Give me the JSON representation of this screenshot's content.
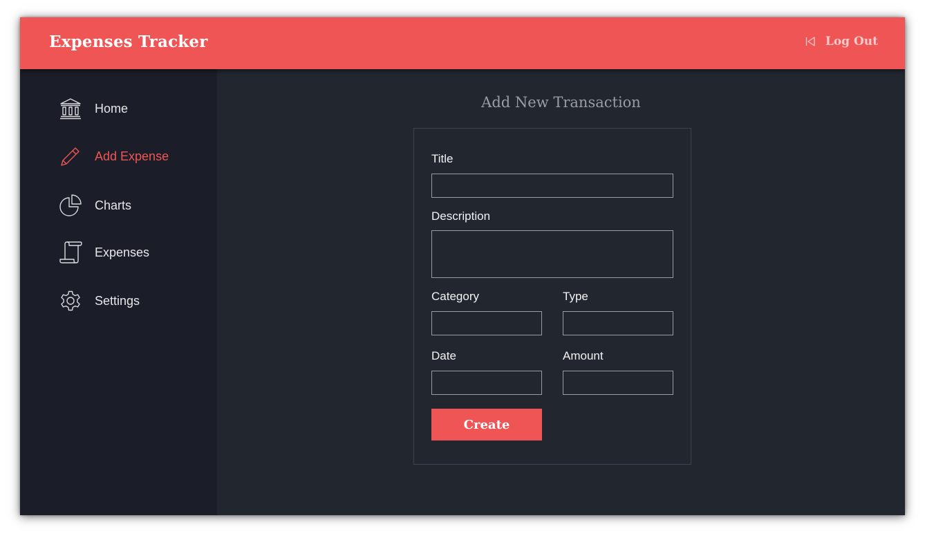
{
  "header": {
    "app_title": "Expenses Tracker",
    "logout_label": "Log Out",
    "logout_icon": "logout-icon"
  },
  "sidebar": {
    "items": [
      {
        "label": "Home",
        "icon": "bank-icon",
        "active": false
      },
      {
        "label": "Add Expense",
        "icon": "pencil-icon",
        "active": true
      },
      {
        "label": "Charts",
        "icon": "pie-chart-icon",
        "active": false
      },
      {
        "label": "Expenses",
        "icon": "scroll-icon",
        "active": false
      },
      {
        "label": "Settings",
        "icon": "gear-icon",
        "active": false
      }
    ]
  },
  "main": {
    "page_title": "Add New Transaction",
    "form": {
      "title_label": "Title",
      "title_value": "",
      "description_label": "Description",
      "description_value": "",
      "category_label": "Category",
      "category_value": "",
      "type_label": "Type",
      "type_value": "",
      "date_label": "Date",
      "date_value": "",
      "amount_label": "Amount",
      "amount_value": "",
      "submit_label": "Create"
    }
  },
  "colors": {
    "accent": "#f05555",
    "sidebar_bg": "#1b1e28",
    "main_bg": "#22262f",
    "logout_text": "#f7c9c9"
  }
}
